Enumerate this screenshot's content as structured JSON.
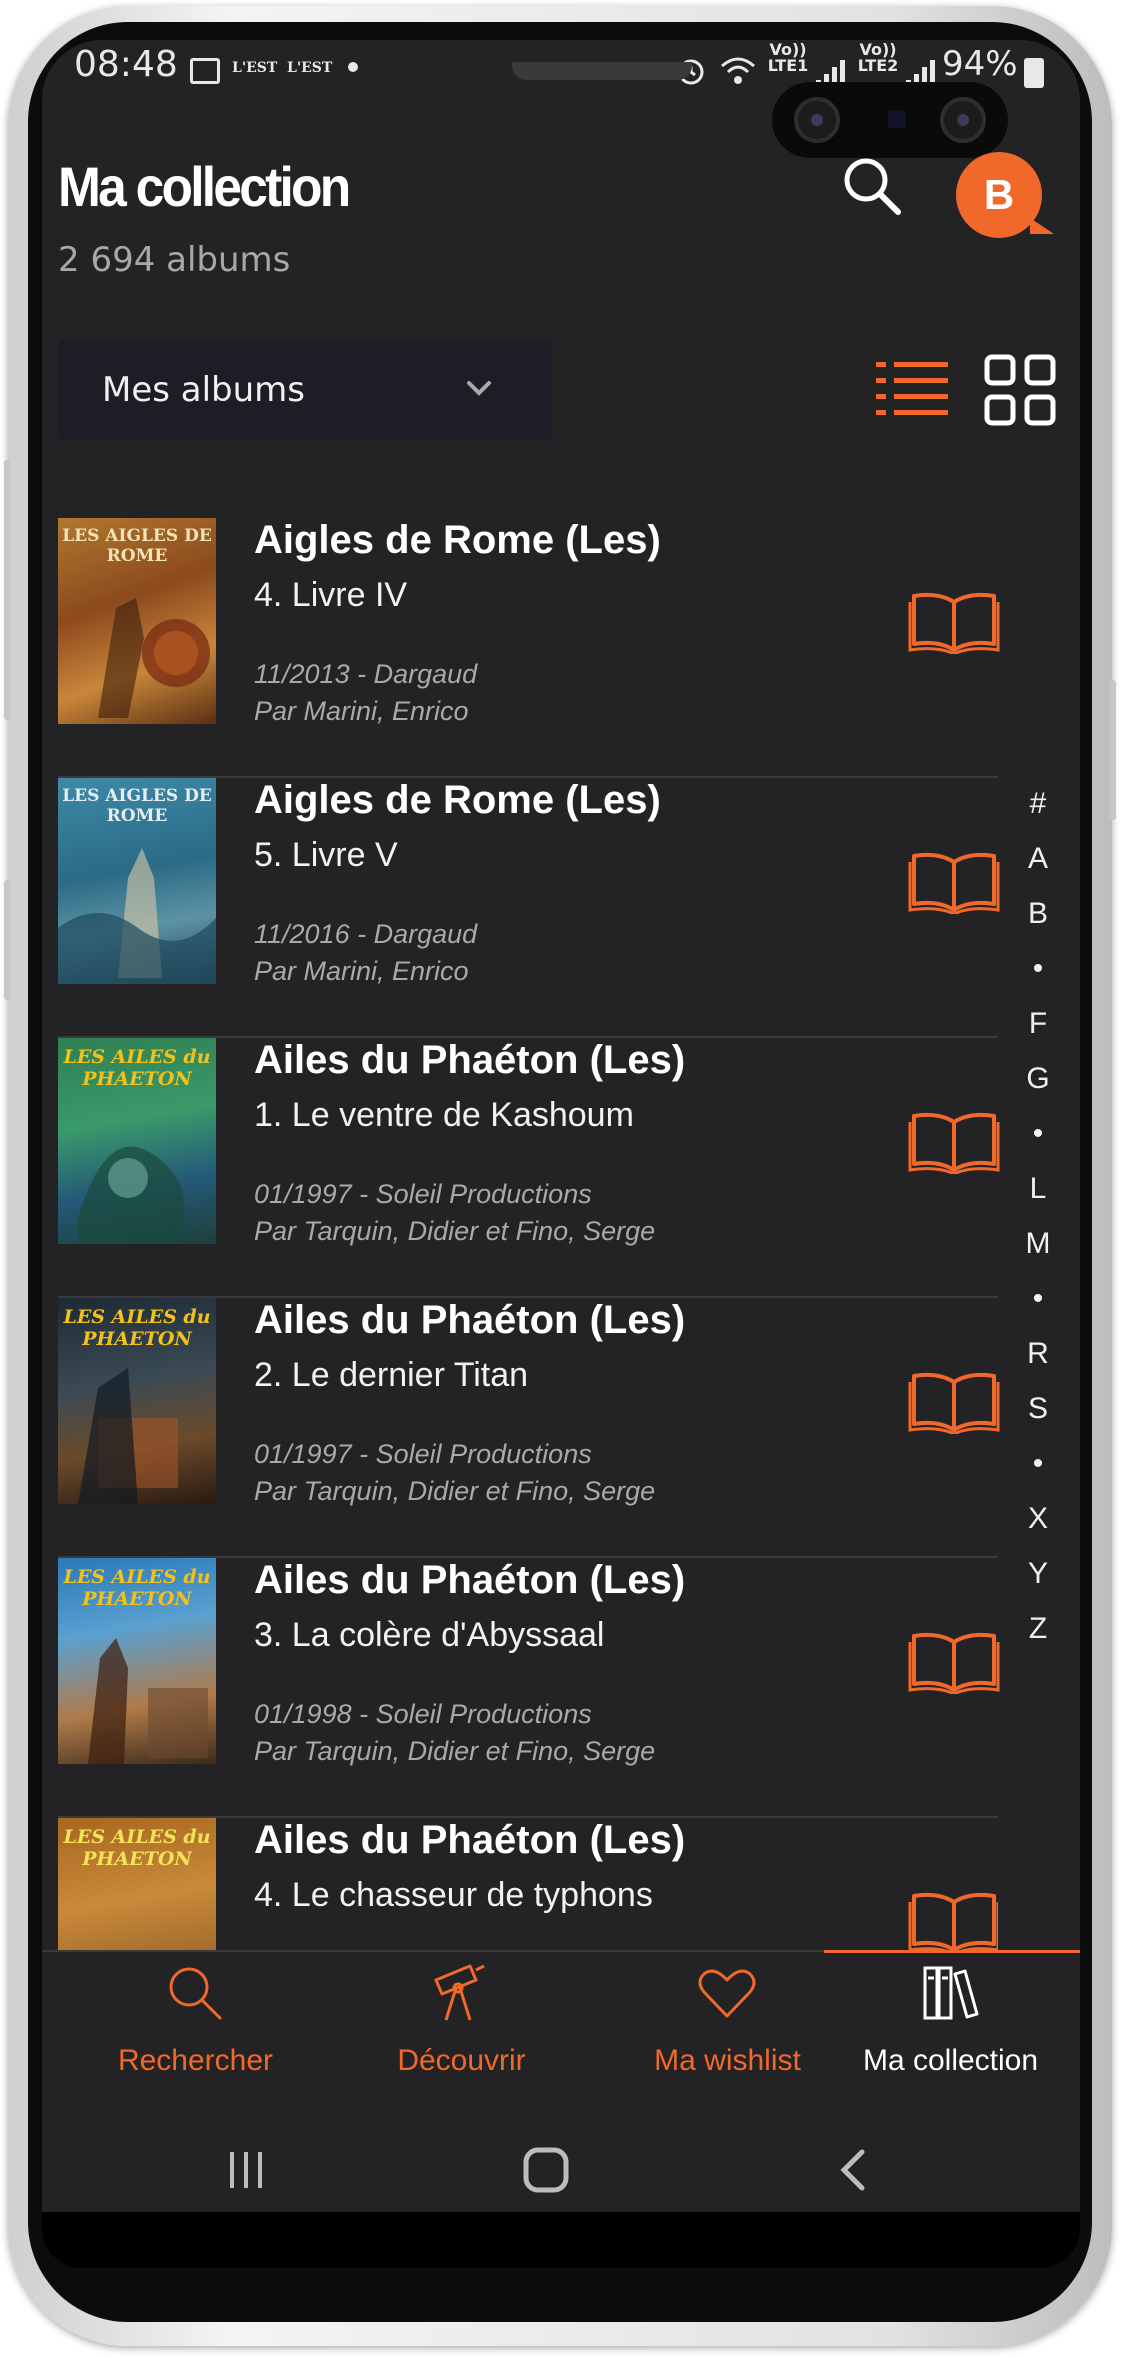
{
  "status_bar": {
    "time": "08:48",
    "carrier_1": "L'EST",
    "carrier_2": "L'EST",
    "sim1": "Vo)) LTE1",
    "sim2": "Vo)) LTE2",
    "battery": "94%"
  },
  "header": {
    "title": "Ma collection",
    "count": "2 694 albums",
    "avatar_letter": "B"
  },
  "filter": {
    "selected": "Mes albums"
  },
  "albums": [
    {
      "series": "Aigles de Rome (Les)",
      "album": "4. Livre IV",
      "date_publisher": "11/2013 - Dargaud",
      "authors": "Par Marini, Enrico",
      "cover_text": "LES AIGLES DE ROME"
    },
    {
      "series": "Aigles de Rome (Les)",
      "album": "5. Livre V",
      "date_publisher": "11/2016 - Dargaud",
      "authors": "Par Marini, Enrico",
      "cover_text": "LES AIGLES DE ROME"
    },
    {
      "series": "Ailes du Phaéton (Les)",
      "album": "1. Le ventre de Kashoum",
      "date_publisher": "01/1997 - Soleil Productions",
      "authors": "Par Tarquin, Didier et Fino, Serge",
      "cover_text": "LES AILES du PHAETON"
    },
    {
      "series": "Ailes du Phaéton (Les)",
      "album": "2. Le dernier Titan",
      "date_publisher": "01/1997 - Soleil Productions",
      "authors": "Par Tarquin, Didier et Fino, Serge",
      "cover_text": "LES AILES du PHAETON"
    },
    {
      "series": "Ailes du Phaéton (Les)",
      "album": "3. La colère d'Abyssaal",
      "date_publisher": "01/1998 - Soleil Productions",
      "authors": "Par Tarquin, Didier et Fino, Serge",
      "cover_text": "LES AILES du PHAETON"
    },
    {
      "series": "Ailes du Phaéton (Les)",
      "album": "4. Le chasseur de typhons",
      "date_publisher": "",
      "authors": "",
      "cover_text": "LES AILES du PHAETON"
    }
  ],
  "alphabet_index": [
    "#",
    "A",
    "B",
    "•",
    "F",
    "G",
    "•",
    "L",
    "M",
    "•",
    "R",
    "S",
    "•",
    "X",
    "Y",
    "Z"
  ],
  "bottom_nav": [
    {
      "label": "Rechercher",
      "icon": "search-icon"
    },
    {
      "label": "Découvrir",
      "icon": "telescope-icon"
    },
    {
      "label": "Ma wishlist",
      "icon": "heart-icon"
    },
    {
      "label": "Ma collection",
      "icon": "books-icon"
    }
  ],
  "colors": {
    "accent": "#f0692a",
    "background": "#232325",
    "text": "#ffffff",
    "muted": "#a9a9a9"
  }
}
